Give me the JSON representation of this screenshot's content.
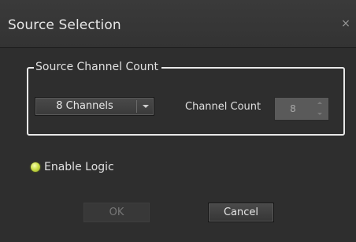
{
  "dialog": {
    "title": "Source Selection",
    "close_glyph": "×"
  },
  "group": {
    "legend": "Source Channel Count"
  },
  "combo": {
    "selected": "8 Channels"
  },
  "channel_count": {
    "label": "Channel Count",
    "value": "8"
  },
  "logic": {
    "label": "Enable Logic",
    "led_color": "#cde04a"
  },
  "buttons": {
    "ok_label": "OK",
    "cancel_label": "Cancel"
  }
}
